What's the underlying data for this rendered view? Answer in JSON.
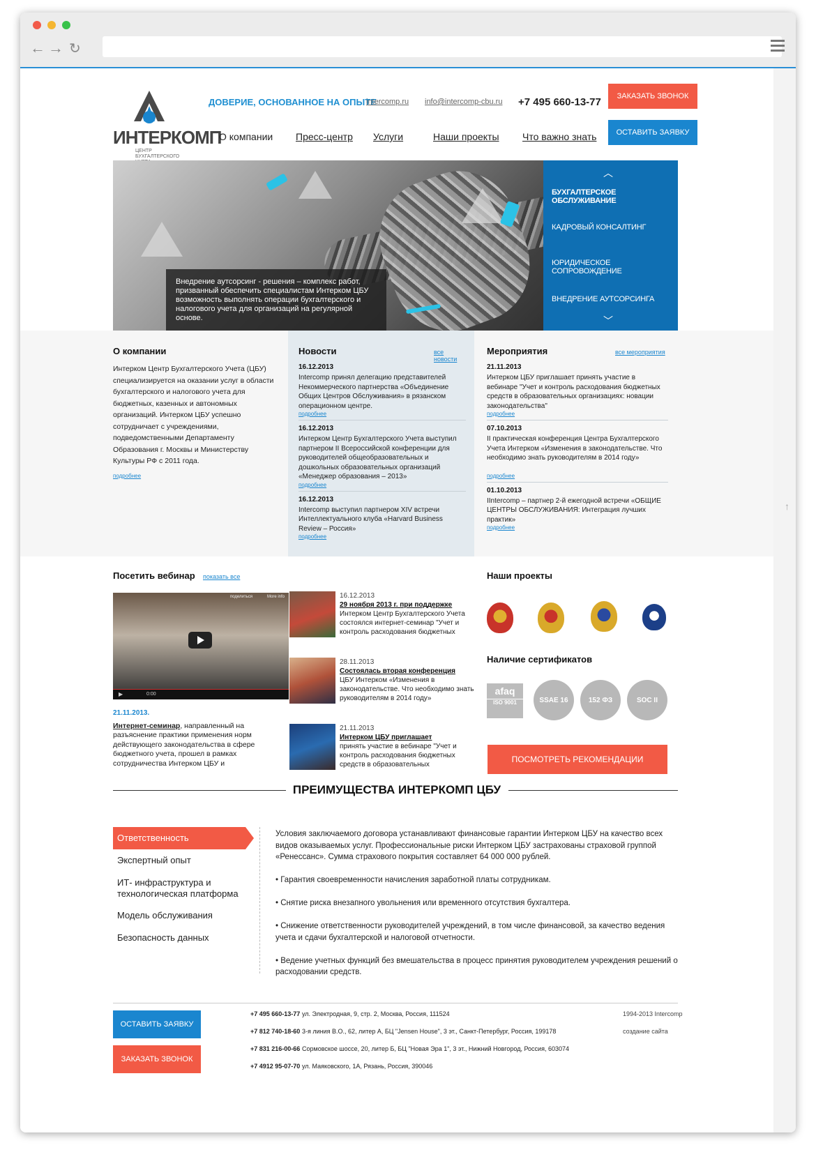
{
  "header": {
    "logo_name": "ИНТЕРКОМП",
    "logo_sub": "ЦЕНТР БУХГАЛТЕРСКОГО УЧЕТА",
    "slogan": "ДОВЕРИЕ, ОСНОВАННОЕ НА ОПЫТЕ",
    "site_link": "intercomp.ru",
    "email_link": "info@intercomp-cbu.ru",
    "phone": "+7 495 660-13-77",
    "call_button": "ЗАКАЗАТЬ ЗВОНОК",
    "request_button": "ОСТАВИТЬ ЗАЯВКУ",
    "nav": [
      "О компании",
      "Пресс-центр",
      "Услуги",
      "Наши проекты",
      "Что важно знать"
    ]
  },
  "hero": {
    "caption": "Внедрение аутсорсинг - решения – комплекс работ, призванный обеспечить специалистам Интерком ЦБУ возможность выполнять операции бухгалтерского и налогового учета для организаций на регулярной основе.",
    "menu": [
      "БУХГАЛТЕРСКОЕ ОБСЛУЖИВАНИЕ",
      "КАДРОВЫЙ КОНСАЛТИНГ",
      "ЮРИДИЧЕСКОЕ СОПРОВОЖДЕНИЕ",
      "ВНЕДРЕНИЕ АУТСОРСИНГА"
    ],
    "up_icon": "chevron-up-icon",
    "down_icon": "chevron-down-icon"
  },
  "about": {
    "title": "О компании",
    "text": "Интерком Центр Бухгалтерского Учета (ЦБУ) специализируется на оказании услуг в области бухгалтерского и налогового учета для бюджетных, казенных и автономных организаций. Интерком ЦБУ успешно сотрудничает с учреждениями, подведомственными Департаменту Образования г. Москвы и Министерству Культуры РФ с 2011 года.",
    "more": "подробнее"
  },
  "news": {
    "title": "Новости",
    "all": "все новости",
    "items": [
      {
        "date": "16.12.2013",
        "text": "Intercomp принял делегацию представителей Некоммерческого партнерства «Объединение Общих Центров Обслуживания» в рязанском операционном центре.",
        "more": "подробнее"
      },
      {
        "date": "16.12.2013",
        "text": "Интерком Центр Бухгалтерского Учета выступил партнером II Всероссийской конференции для руководителей общеобразовательных и дошкольных образовательных организаций «Менеджер образования – 2013»",
        "more": "подробнее"
      },
      {
        "date": "16.12.2013",
        "text": "Intercomp выступил партнером XIV встречи Интеллектуального клуба «Harvard Business Review – Россия»",
        "more": "подробнее"
      }
    ]
  },
  "events": {
    "title": "Мероприятия",
    "all": "все мероприятия",
    "items": [
      {
        "date": "21.11.2013",
        "text": "Интерком ЦБУ приглашает принять участие в вебинаре \"Учет и контроль расходования бюджетных средств в образовательных организациях: новации законодательства\"",
        "more": "подробнее"
      },
      {
        "date": "07.10.2013",
        "text": "II практическая конференция Центра Бухгалтерского Учета Интерком «Изменения в законодательстве. Что необходимо знать руководителям в 2014 году»",
        "more": "подробнее"
      },
      {
        "date": "01.10.2013",
        "text": "IIntercomp – партнер 2-й ежегодной встречи «ОБЩИЕ ЦЕНТРЫ ОБСЛУЖИВАНИЯ: Интеграция лучших практик»",
        "more": "подробнее"
      }
    ]
  },
  "webinar": {
    "title": "Посетить вебинар",
    "show_all": "показать все",
    "video_date": "21.11.2013.",
    "video_title": "Интернет-семинар",
    "video_text": ", направленный на разъяснение практики применения норм действующего законодательства в сфере бюджетного учета, прошел в рамках сотрудничества Интерком ЦБУ и",
    "video_time": "0:00",
    "video_share": "поделиться",
    "video_more": "More info",
    "items": [
      {
        "date": "16.12.2013",
        "title": "29 ноября 2013 г. при поддержке",
        "text": "Интерком Центр Бухгалтерского Учета состоялся интернет-семинар \"Учет и контроль расходования бюджетных"
      },
      {
        "date": "28.11.2013",
        "title": "Состоялась вторая конференция",
        "text": "ЦБУ Интерком «Изменения в законодательстве. Что необходимо знать руководителям в 2014 году»"
      },
      {
        "date": "21.11.2013",
        "title": "Интерком ЦБУ приглашает",
        "text": "принять участие в вебинаре \"Учет и контроль расходования бюджетных средств в образовательных"
      }
    ]
  },
  "projects": {
    "title": "Наши проекты",
    "certs_title": "Наличие сертификатов",
    "certs": [
      "SSAE 16",
      "152 ФЗ",
      "SOC II"
    ],
    "afaq": "afaq",
    "afaq_sub": "ISO 9001",
    "recommend_button": "ПОСМОТРЕТЬ РЕКОМЕНДАЦИИ"
  },
  "advantages": {
    "title": "ПРЕИМУЩЕСТВА ИНТЕРКОМП ЦБУ",
    "tabs": [
      "Ответственность",
      "Экспертный опыт",
      "ИТ- инфраструктура и технологическая платформа",
      "Модель обслуживания",
      "Безопасность данных"
    ],
    "paragraphs": [
      "Условия заключаемого договора устанавливают финансовые гарантии Интерком ЦБУ на качество всех видов оказываемых услуг. Профессиональные риски Интерком ЦБУ застрахованы страховой группой «Ренессанс». Сумма страхового покрытия составляет 64 000 000 рублей.",
      "• Гарантия своевременности начисления заработной платы сотрудникам.",
      "• Снятие риска внезапного увольнения или временного отсутствия бухгалтера.",
      "• Снижение ответственности руководителей учреждений, в том числе финансовой, за качество ведения учета и сдачи бухгалтерской и налоговой отчетности.",
      "• Ведение учетных функций без вмешательства в процесс принятия руководителем учреждения решений о расходовании средств."
    ]
  },
  "footer": {
    "request_button": "ОСТАВИТЬ ЗАЯВКУ",
    "call_button": "ЗАКАЗАТЬ ЗВОНОК",
    "offices": [
      {
        "phone": "+7 495 660-13-77",
        "address": "ул. Электродная, 9, стр. 2, Москва, Россия, 111524"
      },
      {
        "phone": "+7 812 740-18-60",
        "address": "3-я линия В.О., 62, литер А, БЦ \"Jensen House\", 3 эт., Санкт-Петербург, Россия, 199178"
      },
      {
        "phone": "+7 831 216-00-66",
        "address": "Сормовское шоссе, 20, литер Б, БЦ \"Новая Эра 1\", 3 эт., Нижний Новгород, Россия, 603074"
      },
      {
        "phone": "+7 4912 95-07-70",
        "address": "ул. Маяковского, 1А, Рязань, Россия, 390046"
      }
    ],
    "copyright": "1994-2013 Intercomp",
    "made_by": "создание сайта"
  },
  "colors": {
    "accent_blue": "#1a86cf",
    "accent_red": "#f25a45",
    "hero_menu": "#0f6fb3"
  }
}
